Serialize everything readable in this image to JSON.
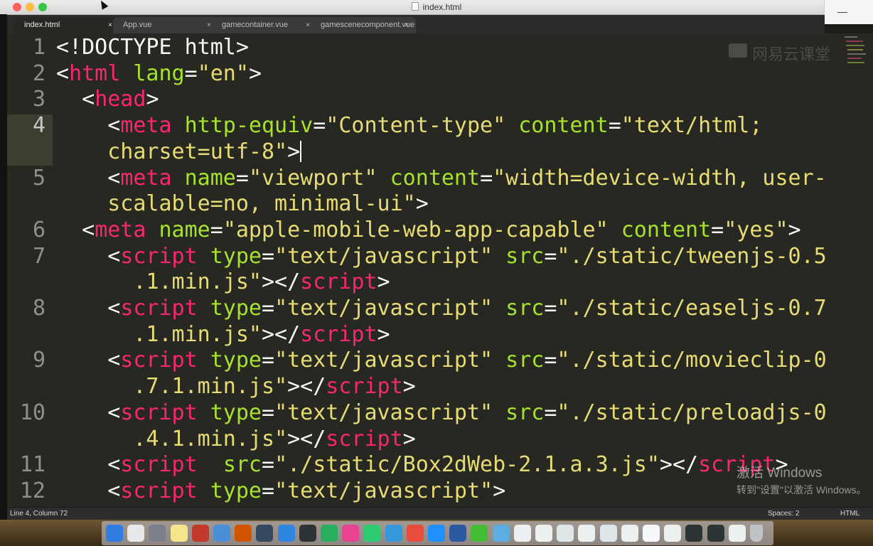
{
  "window": {
    "title": "index.html"
  },
  "tabs": [
    {
      "label": "index.html",
      "close": "×"
    },
    {
      "label": "App.vue",
      "close": "×"
    },
    {
      "label": "gamecontainer.vue",
      "close": "×"
    },
    {
      "label": "gamescenecomponent.vue",
      "close": "×"
    }
  ],
  "window_controls": {
    "minimize": "—"
  },
  "editor": {
    "line_numbers": [
      "1",
      "2",
      "3",
      "4",
      "5",
      "6",
      "7",
      "8",
      "9",
      "10",
      "11",
      "12"
    ],
    "current_line": "4",
    "code_rows": [
      [
        {
          "t": "pt",
          "v": "<!DOCTYPE html>"
        }
      ],
      [
        {
          "t": "pt",
          "v": "<"
        },
        {
          "t": "tg",
          "v": "html"
        },
        {
          "t": "pt",
          "v": " "
        },
        {
          "t": "at",
          "v": "lang"
        },
        {
          "t": "pt",
          "v": "="
        },
        {
          "t": "st",
          "v": "\"en\""
        },
        {
          "t": "pt",
          "v": ">"
        }
      ],
      [
        {
          "t": "pt",
          "v": "  <"
        },
        {
          "t": "tg",
          "v": "head"
        },
        {
          "t": "pt",
          "v": ">"
        }
      ],
      [
        {
          "t": "pt",
          "v": "    <"
        },
        {
          "t": "tg",
          "v": "meta"
        },
        {
          "t": "pt",
          "v": " "
        },
        {
          "t": "at",
          "v": "http-equiv"
        },
        {
          "t": "pt",
          "v": "="
        },
        {
          "t": "st",
          "v": "\"Content-type\""
        },
        {
          "t": "pt",
          "v": " "
        },
        {
          "t": "at",
          "v": "content"
        },
        {
          "t": "pt",
          "v": "="
        },
        {
          "t": "st",
          "v": "\"text/html;"
        }
      ],
      [
        {
          "t": "st",
          "v": "    charset=utf-8\""
        },
        {
          "t": "pt",
          "v": ">"
        },
        {
          "t": "caret",
          "v": ""
        }
      ],
      [
        {
          "t": "pt",
          "v": "    <"
        },
        {
          "t": "tg",
          "v": "meta"
        },
        {
          "t": "pt",
          "v": " "
        },
        {
          "t": "at",
          "v": "name"
        },
        {
          "t": "pt",
          "v": "="
        },
        {
          "t": "st",
          "v": "\"viewport\""
        },
        {
          "t": "pt",
          "v": " "
        },
        {
          "t": "at",
          "v": "content"
        },
        {
          "t": "pt",
          "v": "="
        },
        {
          "t": "st",
          "v": "\"width=device-width, user-"
        }
      ],
      [
        {
          "t": "st",
          "v": "    scalable=no, minimal-ui\""
        },
        {
          "t": "pt",
          "v": ">"
        }
      ],
      [
        {
          "t": "pt",
          "v": "  <"
        },
        {
          "t": "tg",
          "v": "meta"
        },
        {
          "t": "pt",
          "v": " "
        },
        {
          "t": "at",
          "v": "name"
        },
        {
          "t": "pt",
          "v": "="
        },
        {
          "t": "st",
          "v": "\"apple-mobile-web-app-capable\""
        },
        {
          "t": "pt",
          "v": " "
        },
        {
          "t": "at",
          "v": "content"
        },
        {
          "t": "pt",
          "v": "="
        },
        {
          "t": "st",
          "v": "\"yes\""
        },
        {
          "t": "pt",
          "v": ">"
        }
      ],
      [
        {
          "t": "pt",
          "v": "    <"
        },
        {
          "t": "tg",
          "v": "script"
        },
        {
          "t": "pt",
          "v": " "
        },
        {
          "t": "at",
          "v": "type"
        },
        {
          "t": "pt",
          "v": "="
        },
        {
          "t": "st",
          "v": "\"text/javascript\""
        },
        {
          "t": "pt",
          "v": " "
        },
        {
          "t": "at",
          "v": "src"
        },
        {
          "t": "pt",
          "v": "="
        },
        {
          "t": "st",
          "v": "\"./static/tweenjs-0.5"
        }
      ],
      [
        {
          "t": "st",
          "v": "      .1.min.js\""
        },
        {
          "t": "pt",
          "v": "></"
        },
        {
          "t": "tg",
          "v": "script"
        },
        {
          "t": "pt",
          "v": ">"
        }
      ],
      [
        {
          "t": "pt",
          "v": "    <"
        },
        {
          "t": "tg",
          "v": "script"
        },
        {
          "t": "pt",
          "v": " "
        },
        {
          "t": "at",
          "v": "type"
        },
        {
          "t": "pt",
          "v": "="
        },
        {
          "t": "st",
          "v": "\"text/javascript\""
        },
        {
          "t": "pt",
          "v": " "
        },
        {
          "t": "at",
          "v": "src"
        },
        {
          "t": "pt",
          "v": "="
        },
        {
          "t": "st",
          "v": "\"./static/easeljs-0.7"
        }
      ],
      [
        {
          "t": "st",
          "v": "      .1.min.js\""
        },
        {
          "t": "pt",
          "v": "></"
        },
        {
          "t": "tg",
          "v": "script"
        },
        {
          "t": "pt",
          "v": ">"
        }
      ],
      [
        {
          "t": "pt",
          "v": "    <"
        },
        {
          "t": "tg",
          "v": "script"
        },
        {
          "t": "pt",
          "v": " "
        },
        {
          "t": "at",
          "v": "type"
        },
        {
          "t": "pt",
          "v": "="
        },
        {
          "t": "st",
          "v": "\"text/javascript\""
        },
        {
          "t": "pt",
          "v": " "
        },
        {
          "t": "at",
          "v": "src"
        },
        {
          "t": "pt",
          "v": "="
        },
        {
          "t": "st",
          "v": "\"./static/movieclip-0"
        }
      ],
      [
        {
          "t": "st",
          "v": "      .7.1.min.js\""
        },
        {
          "t": "pt",
          "v": "></"
        },
        {
          "t": "tg",
          "v": "script"
        },
        {
          "t": "pt",
          "v": ">"
        }
      ],
      [
        {
          "t": "pt",
          "v": "    <"
        },
        {
          "t": "tg",
          "v": "script"
        },
        {
          "t": "pt",
          "v": " "
        },
        {
          "t": "at",
          "v": "type"
        },
        {
          "t": "pt",
          "v": "="
        },
        {
          "t": "st",
          "v": "\"text/javascript\""
        },
        {
          "t": "pt",
          "v": " "
        },
        {
          "t": "at",
          "v": "src"
        },
        {
          "t": "pt",
          "v": "="
        },
        {
          "t": "st",
          "v": "\"./static/preloadjs-0"
        }
      ],
      [
        {
          "t": "st",
          "v": "      .4.1.min.js\""
        },
        {
          "t": "pt",
          "v": "></"
        },
        {
          "t": "tg",
          "v": "script"
        },
        {
          "t": "pt",
          "v": ">"
        }
      ],
      [
        {
          "t": "pt",
          "v": "    <"
        },
        {
          "t": "tg",
          "v": "script"
        },
        {
          "t": "pt",
          "v": "  "
        },
        {
          "t": "at",
          "v": "src"
        },
        {
          "t": "pt",
          "v": "="
        },
        {
          "t": "st",
          "v": "\"./static/Box2dWeb-2.1.a.3.js\""
        },
        {
          "t": "pt",
          "v": "></"
        },
        {
          "t": "tg",
          "v": "script"
        },
        {
          "t": "pt",
          "v": ">"
        }
      ],
      [
        {
          "t": "pt",
          "v": "    <"
        },
        {
          "t": "tg",
          "v": "script"
        },
        {
          "t": "pt",
          "v": " "
        },
        {
          "t": "at",
          "v": "type"
        },
        {
          "t": "pt",
          "v": "="
        },
        {
          "t": "st",
          "v": "\"text/javascript\""
        },
        {
          "t": "pt",
          "v": ">"
        }
      ]
    ]
  },
  "watermark": {
    "text": "网易云课堂"
  },
  "activation": {
    "line1": "激活 Windows",
    "line2": "转到\"设置\"以激活 Windows。"
  },
  "status": {
    "position": "Line 4, Column 72",
    "spaces": "Spaces: 2",
    "syntax": "HTML"
  },
  "theme": {
    "tag": "#f92672",
    "attr": "#a6e22e",
    "string": "#e6db74",
    "text": "#f8f8f2",
    "background": "#272822"
  },
  "dock": {
    "icons": [
      "finder-icon",
      "chrome-icon",
      "launchpad-icon",
      "notes-icon",
      "photo-booth-icon",
      "preview-icon",
      "sublime-text-icon",
      "reader-icon",
      "safari-icon",
      "terminal-icon",
      "sourcetree-icon",
      "itunes-icon",
      "qq-music-icon",
      "bird-icon",
      "office-icon",
      "ie-icon",
      "word-icon",
      "wechat-icon",
      "folder-icon",
      "thumb-icon",
      "thumb-icon",
      "thumb-icon",
      "thumb-icon",
      "thumb-icon",
      "thumb-icon",
      "thumb-icon",
      "thumb-icon",
      "thumb-icon",
      "thumb-icon",
      "thumb-icon",
      "trash-icon"
    ]
  }
}
